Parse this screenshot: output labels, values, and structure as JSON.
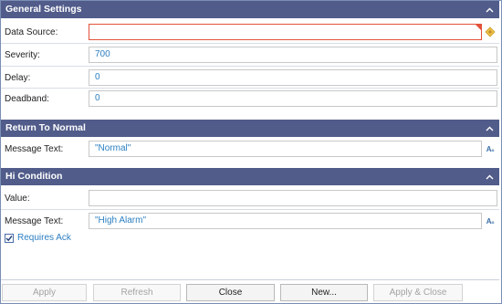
{
  "general_settings": {
    "title": "General Settings",
    "fields": [
      {
        "label": "Data Source:",
        "value": ""
      },
      {
        "label": "Severity:",
        "value": "700"
      },
      {
        "label": "Delay:",
        "value": "0"
      },
      {
        "label": "Deadband:",
        "value": "0"
      }
    ]
  },
  "return_to_normal": {
    "title": "Return To Normal",
    "message_label": "Message Text:",
    "message_value": "\"Normal\""
  },
  "hi_condition": {
    "title": "Hi Condition",
    "value_label": "Value:",
    "value_value": "",
    "message_label": "Message Text:",
    "message_value": "\"High Alarm\"",
    "requires_ack_label": "Requires Ack",
    "requires_ack_checked": true
  },
  "footer": {
    "apply": "Apply",
    "refresh": "Refresh",
    "close": "Close",
    "new": "New...",
    "apply_close": "Apply & Close"
  },
  "colors": {
    "header_bg": "#515c8a",
    "value_text": "#2b7fc2",
    "error_border": "#e2523a"
  }
}
